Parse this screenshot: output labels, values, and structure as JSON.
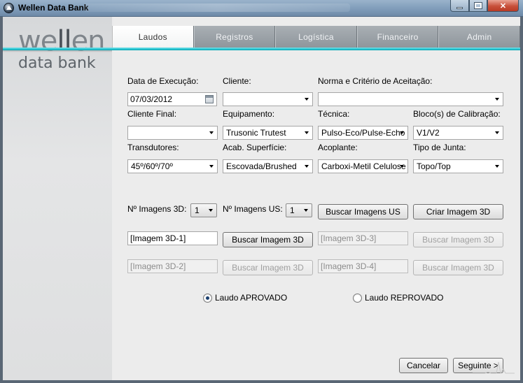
{
  "window": {
    "title": "Wellen Data Bank"
  },
  "logo": {
    "line1": "wellen",
    "line2": "data bank"
  },
  "tabs": [
    {
      "label": "Laudos",
      "active": true
    },
    {
      "label": "Registros",
      "active": false
    },
    {
      "label": "Logística",
      "active": false
    },
    {
      "label": "Financeiro",
      "active": false
    },
    {
      "label": "Admin",
      "active": false
    }
  ],
  "form": {
    "data_execucao": {
      "label": "Data de Execução:",
      "value": "07/03/2012"
    },
    "cliente": {
      "label": "Cliente:",
      "value": ""
    },
    "norma": {
      "label": "Norma e Critério de Aceitação:",
      "value": ""
    },
    "cliente_final": {
      "label": "Cliente Final:",
      "value": ""
    },
    "equipamento": {
      "label": "Equipamento:",
      "value": "Trusonic Trutest"
    },
    "tecnica": {
      "label": "Técnica:",
      "value": "Pulso-Eco/Pulse-Echo"
    },
    "bloco": {
      "label": "Bloco(s) de Calibração:",
      "value": "V1/V2"
    },
    "transdutores": {
      "label": "Transdutores:",
      "value": "45º/60º/70º"
    },
    "acab": {
      "label": "Acab. Superfície:",
      "value": "Escovada/Brushed"
    },
    "acoplante": {
      "label": "Acoplante:",
      "value": "Carboxi-Metil Celulose"
    },
    "tipo_junta": {
      "label": "Tipo de Junta:",
      "value": "Topo/Top"
    },
    "n_imagens_3d": {
      "label": "Nº Imagens 3D:",
      "value": "1"
    },
    "n_imagens_us": {
      "label": "Nº Imagens US:",
      "value": "1"
    },
    "buscar_imagens_us": "Buscar Imagens US",
    "criar_imagem_3d": "Criar Imagem 3D",
    "img3d_1": "[Imagem 3D-1]",
    "img3d_2": "[Imagem 3D-2]",
    "img3d_3": "[Imagem 3D-3]",
    "img3d_4": "[Imagem 3D-4]",
    "buscar_imagem_3d": "Buscar Imagem 3D",
    "aprovado": "Laudo APROVADO",
    "reprovado": "Laudo REPROVADO",
    "cancelar": "Cancelar",
    "seguinte": "Seguinte >"
  }
}
